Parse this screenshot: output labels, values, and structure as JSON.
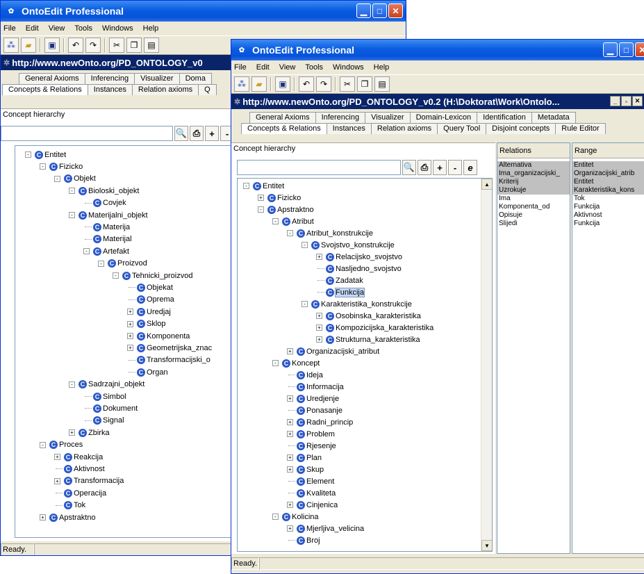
{
  "back_window": {
    "title": "OntoEdit Professional",
    "menu": [
      "File",
      "Edit",
      "View",
      "Tools",
      "Windows",
      "Help"
    ],
    "url": "http://www.newOnto.org/PD_ONTOLOGY_v0",
    "tabs_row1": [
      "General Axioms",
      "Inferencing",
      "Visualizer",
      "Doma"
    ],
    "tabs_row2": [
      "Concepts & Relations",
      "Instances",
      "Relation axioms",
      "Q"
    ],
    "panel_title": "Concept hierarchy",
    "tree": [
      {
        "label": "Entitet",
        "expander": "-"
      },
      {
        "label": "Fizicko",
        "expander": "-"
      },
      {
        "label": "Objekt",
        "expander": "-"
      },
      {
        "label": "Bioloski_objekt",
        "expander": "-"
      },
      {
        "label": "Covjek",
        "expander": ""
      },
      {
        "label": "Materijalni_objekt",
        "expander": "-"
      },
      {
        "label": "Materija",
        "expander": ""
      },
      {
        "label": "Materijal",
        "expander": ""
      },
      {
        "label": "Artefakt",
        "expander": "-"
      },
      {
        "label": "Proizvod",
        "expander": "-"
      },
      {
        "label": "Tehnicki_proizvod",
        "expander": "-"
      },
      {
        "label": "Objekat",
        "expander": ""
      },
      {
        "label": "Oprema",
        "expander": ""
      },
      {
        "label": "Uredjaj",
        "expander": "+"
      },
      {
        "label": "Sklop",
        "expander": "+"
      },
      {
        "label": "Komponenta",
        "expander": "+"
      },
      {
        "label": "Geometrijska_znac",
        "expander": "+"
      },
      {
        "label": "Transformacijski_o",
        "expander": ""
      },
      {
        "label": "Organ",
        "expander": ""
      },
      {
        "label": "Sadrzajni_objekt",
        "expander": "-"
      },
      {
        "label": "Simbol",
        "expander": ""
      },
      {
        "label": "Dokument",
        "expander": ""
      },
      {
        "label": "Signal",
        "expander": ""
      },
      {
        "label": "Zbirka",
        "expander": "+"
      },
      {
        "label": "Proces",
        "expander": "-"
      },
      {
        "label": "Reakcija",
        "expander": "+"
      },
      {
        "label": "Aktivnost",
        "expander": ""
      },
      {
        "label": "Transformacija",
        "expander": "+"
      },
      {
        "label": "Operacija",
        "expander": ""
      },
      {
        "label": "Tok",
        "expander": ""
      },
      {
        "label": "Apstraktno",
        "expander": "+"
      }
    ],
    "status": "Ready."
  },
  "front_window": {
    "title": "OntoEdit Professional",
    "menu": [
      "File",
      "Edit",
      "View",
      "Tools",
      "Windows",
      "Help"
    ],
    "url": "http://www.newOnto.org/PD_ONTOLOGY_v0.2 (H:\\Doktorat\\Work\\Ontolo...",
    "tabs_row1": [
      "General Axioms",
      "Inferencing",
      "Visualizer",
      "Domain-Lexicon",
      "Identification",
      "Metadata"
    ],
    "tabs_row2": [
      "Concepts & Relations",
      "Instances",
      "Relation axioms",
      "Query Tool",
      "Disjoint concepts",
      "Rule Editor"
    ],
    "panel_title": "Concept hierarchy",
    "tree": [
      {
        "label": "Entitet",
        "expander": "-"
      },
      {
        "label": "Fizicko",
        "expander": "+"
      },
      {
        "label": "Apstraktno",
        "expander": "-"
      },
      {
        "label": "Atribut",
        "expander": "-"
      },
      {
        "label": "Atribut_konstrukcije",
        "expander": "-"
      },
      {
        "label": "Svojstvo_konstrukcije",
        "expander": "-"
      },
      {
        "label": "Relacijsko_svojstvo",
        "expander": "+"
      },
      {
        "label": "Nasljedno_svojstvo",
        "expander": ""
      },
      {
        "label": "Zadatak",
        "expander": ""
      },
      {
        "label": "Funkcija",
        "expander": ""
      },
      {
        "label": "Karakteristika_konstrukcije",
        "expander": "-"
      },
      {
        "label": "Osobinska_karakteristika",
        "expander": "+"
      },
      {
        "label": "Kompozicijska_karakteristika",
        "expander": "+"
      },
      {
        "label": "Strukturna_karakteristika",
        "expander": "+"
      },
      {
        "label": "Organizacijski_atribut",
        "expander": "+"
      },
      {
        "label": "Koncept",
        "expander": "-"
      },
      {
        "label": "Ideja",
        "expander": ""
      },
      {
        "label": "Informacija",
        "expander": ""
      },
      {
        "label": "Uredjenje",
        "expander": "+"
      },
      {
        "label": "Ponasanje",
        "expander": ""
      },
      {
        "label": "Radni_princip",
        "expander": "+"
      },
      {
        "label": "Problem",
        "expander": "+"
      },
      {
        "label": "Rjesenje",
        "expander": ""
      },
      {
        "label": "Plan",
        "expander": "+"
      },
      {
        "label": "Skup",
        "expander": "+"
      },
      {
        "label": "Element",
        "expander": ""
      },
      {
        "label": "Kvaliteta",
        "expander": ""
      },
      {
        "label": "Cinjenica",
        "expander": "+"
      },
      {
        "label": "Kolicina",
        "expander": "-"
      },
      {
        "label": "Mjerljiva_velicina",
        "expander": "+"
      },
      {
        "label": "Broj",
        "expander": ""
      }
    ],
    "selected_node": "Funkcija",
    "relations_header": "Relations",
    "range_header": "Range",
    "relations": [
      {
        "name": "Alternativa",
        "range": "Entitet",
        "inherited": true
      },
      {
        "name": "Ima_organizacijski_",
        "range": "Organizacijski_atrib",
        "inherited": true
      },
      {
        "name": "Kriterij",
        "range": "Entitet",
        "inherited": true
      },
      {
        "name": "Uzrokuje",
        "range": "Karakteristika_kons",
        "inherited": true
      },
      {
        "name": "Ima",
        "range": "Tok",
        "inherited": false
      },
      {
        "name": "Komponenta_od",
        "range": "Funkcija",
        "inherited": false
      },
      {
        "name": "Opisuje",
        "range": "Aktivnost",
        "inherited": false
      },
      {
        "name": "Slijedi",
        "range": "Funkcija",
        "inherited": false
      }
    ],
    "status": "Ready."
  }
}
